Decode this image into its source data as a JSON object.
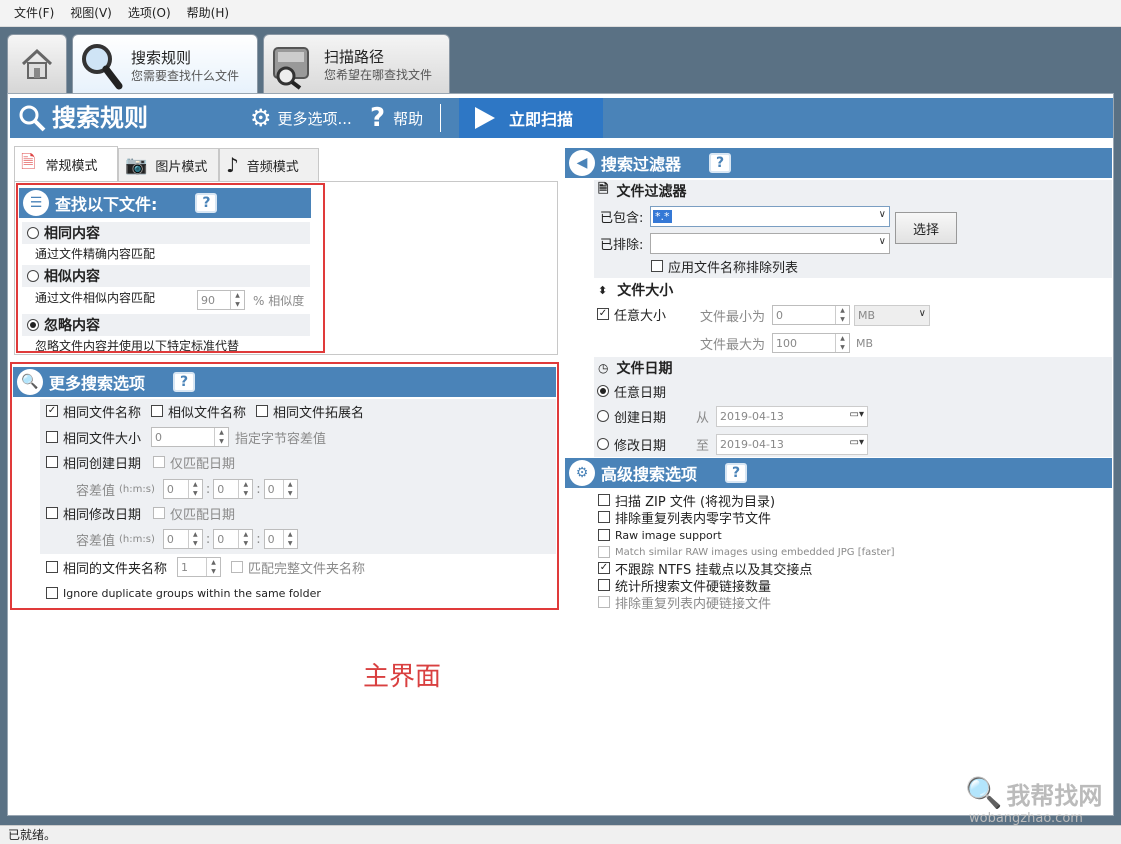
{
  "menu": {
    "file": "文件(F)",
    "view": "视图(V)",
    "options": "选项(O)",
    "help": "帮助(H)"
  },
  "tabs": {
    "search": {
      "title": "搜索规则",
      "subtitle": "您需要查找什么文件"
    },
    "scan": {
      "title": "扫描路径",
      "subtitle": "您希望在哪查找文件"
    }
  },
  "toolbar": {
    "title": "搜索规则",
    "more": "更多选项...",
    "help": "帮助",
    "scan": "立即扫描"
  },
  "mode_tabs": {
    "normal": "常规模式",
    "image": "图片模式",
    "audio": "音频模式"
  },
  "find": {
    "header": "查找以下文件:",
    "help": "?",
    "same": {
      "label": "相同内容",
      "desc": "通过文件精确内容匹配"
    },
    "similar": {
      "label": "相似内容",
      "desc": "通过文件相似内容匹配",
      "value": "90",
      "unit": "% 相似度"
    },
    "ignore": {
      "label": "忽略内容",
      "desc": "忽略文件内容并使用以下特定标准代替"
    }
  },
  "more": {
    "header": "更多搜索选项",
    "same_name": "相同文件名称",
    "similar_name": "相似文件名称",
    "same_ext": "相同文件拓展名",
    "same_size": "相同文件大小",
    "size_value": "0",
    "size_hint": "指定字节容差值",
    "same_created": "相同创建日期",
    "only_date": "仅匹配日期",
    "tolerance": "容差值",
    "hms": "(h:m:s)",
    "zero": "0",
    "same_modified": "相同修改日期",
    "only_date2": "仅匹配日期",
    "same_folder": "相同的文件夹名称",
    "folder_value": "1",
    "match_full": "匹配完整文件夹名称",
    "ignore_groups": "Ignore duplicate groups within the same folder"
  },
  "filter": {
    "header": "搜索过滤器",
    "file_filter": "文件过滤器",
    "included": "已包含:",
    "included_value": "*.*",
    "excluded": "已排除:",
    "excluded_value": "",
    "choose": "选择",
    "apply_exclude": "应用文件名称排除列表",
    "size_header": "文件大小",
    "any_size": "任意大小",
    "min": "文件最小为",
    "min_value": "0",
    "max": "文件最大为",
    "max_value": "100",
    "unit": "MB",
    "date_header": "文件日期",
    "any_date": "任意日期",
    "created": "创建日期",
    "from": "从",
    "date1": "2019-04-13",
    "modified": "修改日期",
    "to": "至",
    "date2": "2019-04-13"
  },
  "advanced": {
    "header": "高级搜索选项",
    "items": [
      "扫描 ZIP 文件 (将视为目录)",
      "排除重复列表内零字节文件",
      "Raw image support",
      "Match similar RAW images using embedded JPG [faster]",
      "不跟踪 NTFS 挂载点以及其交接点",
      "统计所搜索文件硬链接数量",
      "排除重复列表内硬链接文件"
    ]
  },
  "caption": "主界面",
  "watermark": {
    "cn": "我帮找网",
    "url": "wobangzhao.com"
  },
  "status": "已就绪。",
  "colors": {
    "accent": "#4a83b8",
    "scan": "#2e77c5",
    "annotation": "#e03a3a"
  }
}
